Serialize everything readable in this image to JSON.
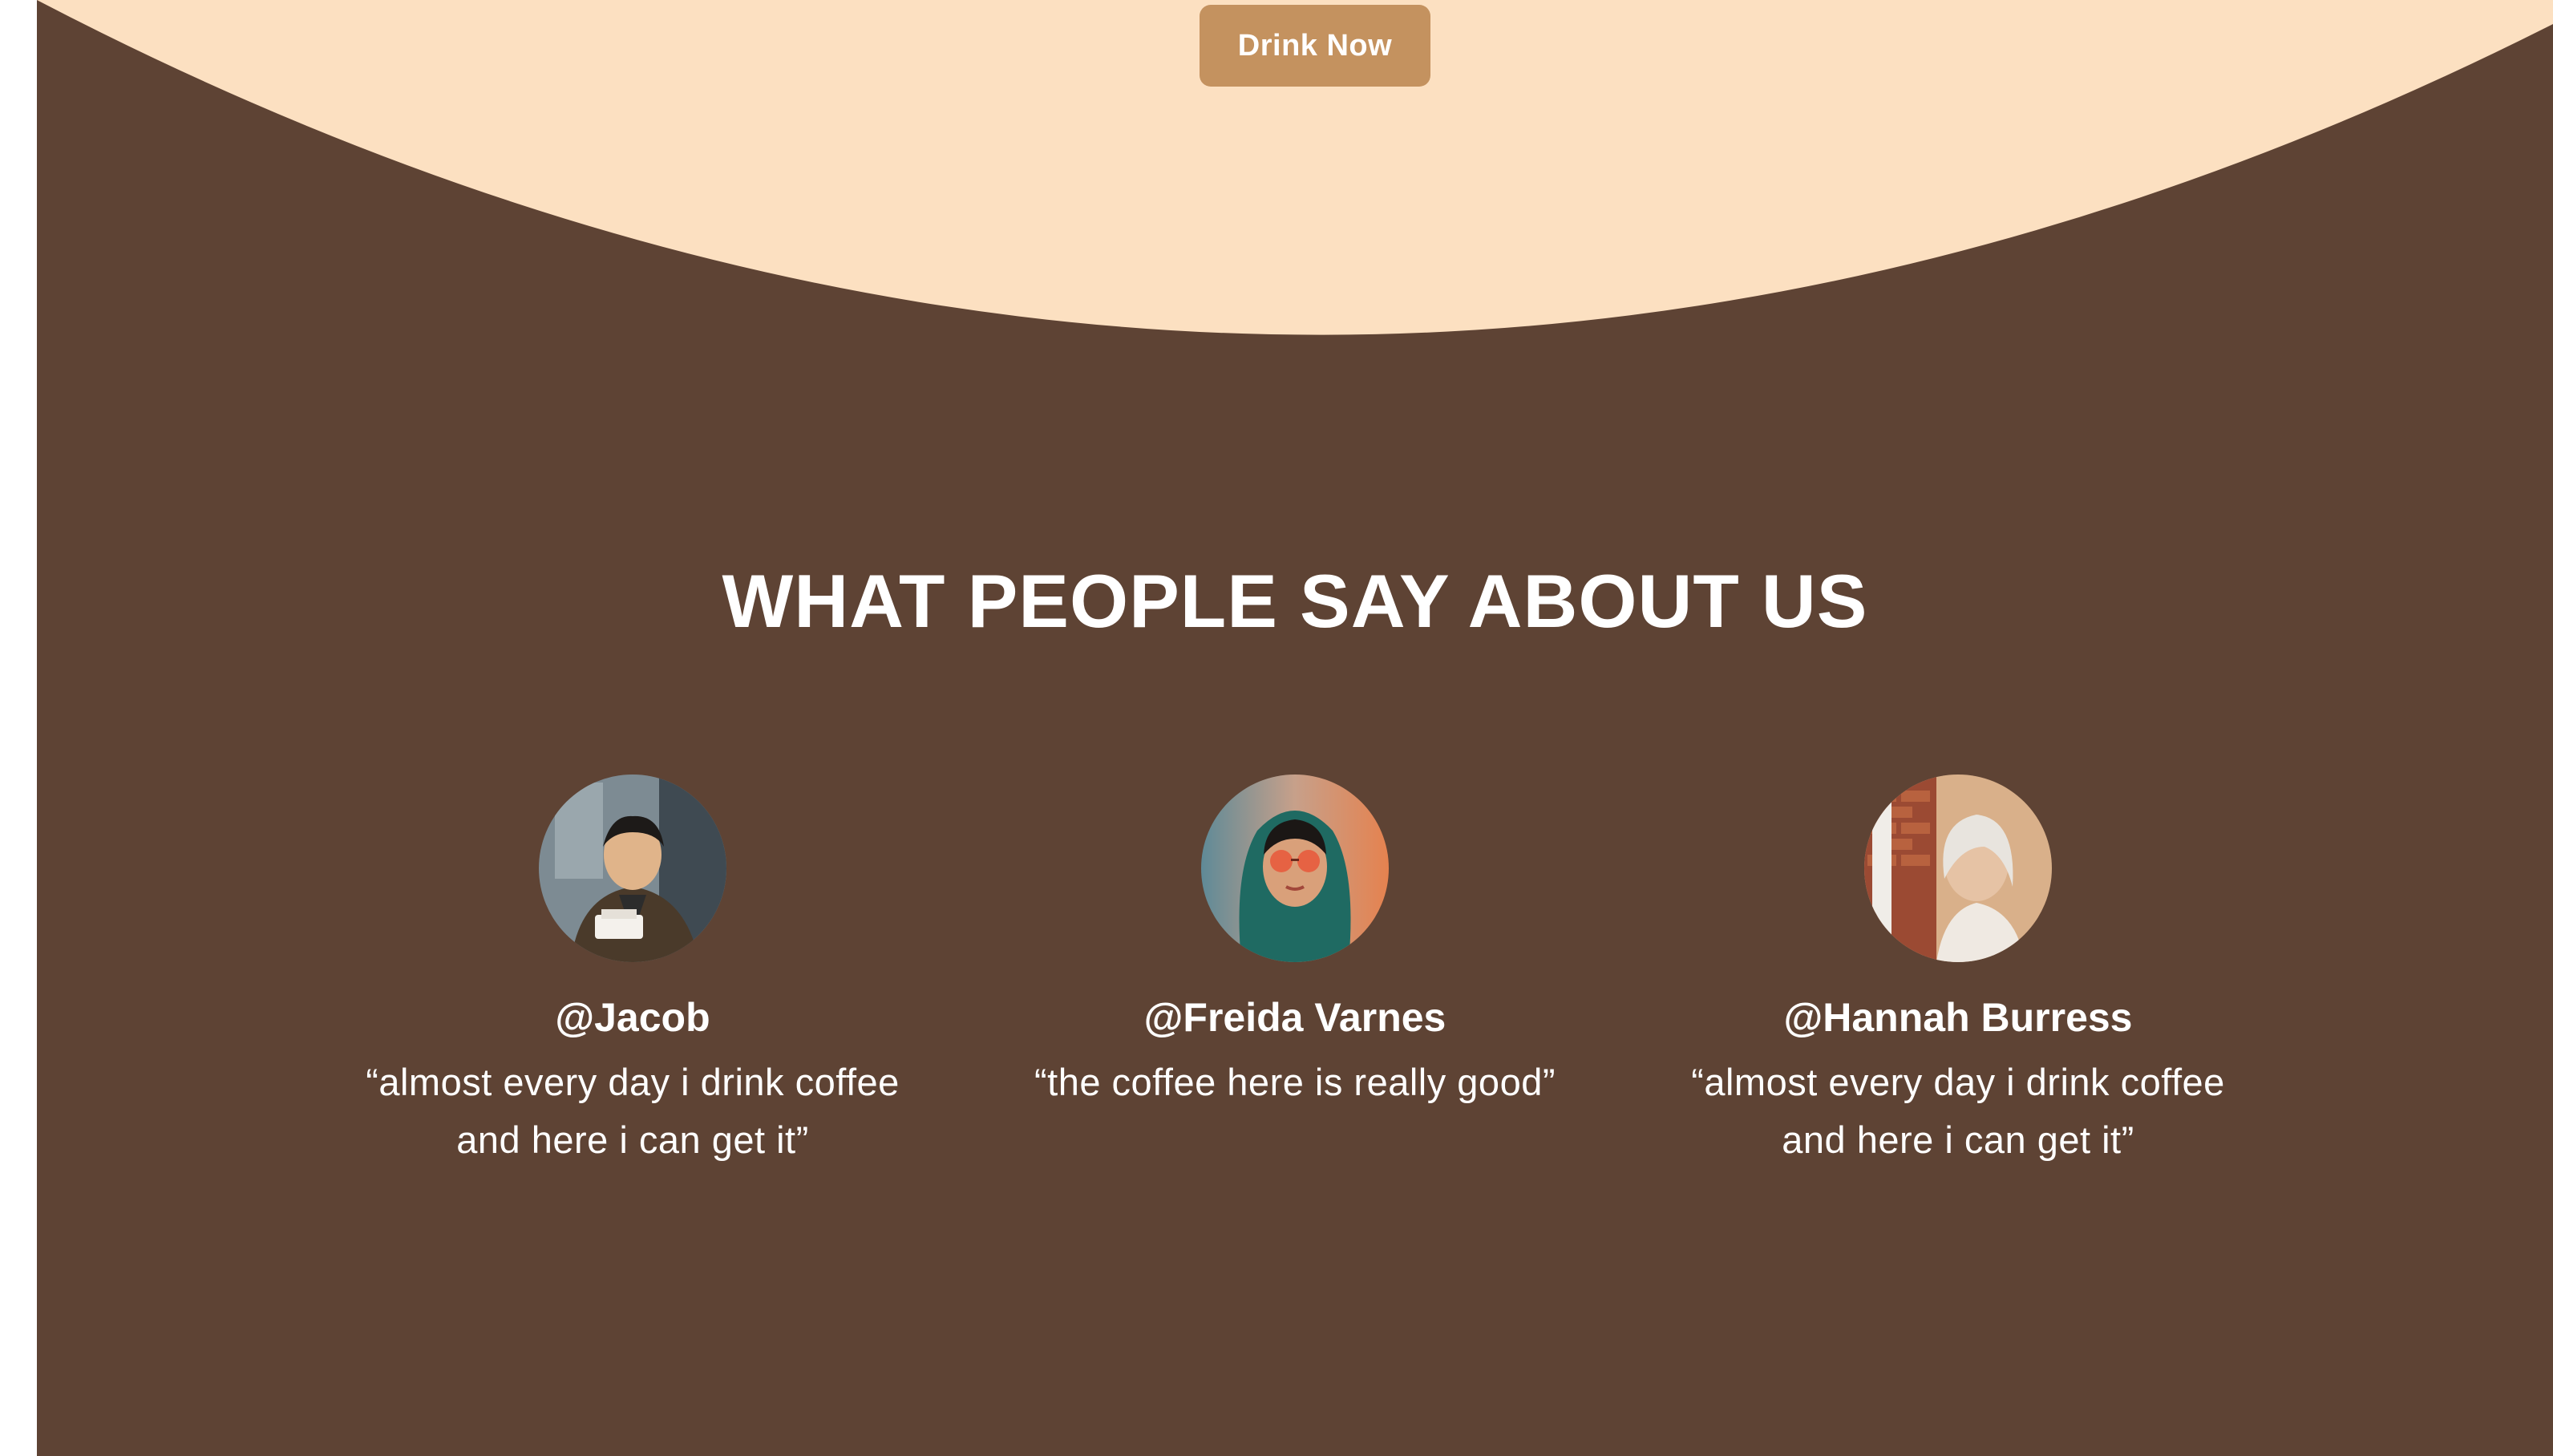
{
  "colors": {
    "background_brown": "#5e4334",
    "hero_cream": "#fce0c1",
    "button_tan": "#c4925f",
    "text_white": "#ffffff"
  },
  "hero": {
    "cta_label": "Drink Now"
  },
  "testimonials_section": {
    "title": "WHAT PEOPLE SAY ABOUT US",
    "items": [
      {
        "handle": "@Jacob",
        "quote": "“almost every day i drink coffee and here i can get it”",
        "avatar": "avatar-photo"
      },
      {
        "handle": "@Freida Varnes",
        "quote": "“the coffee here is really good”",
        "avatar": "avatar-photo"
      },
      {
        "handle": "@Hannah Burress",
        "quote": "“almost every day i drink coffee and here i can get it”",
        "avatar": "avatar-photo"
      }
    ]
  }
}
